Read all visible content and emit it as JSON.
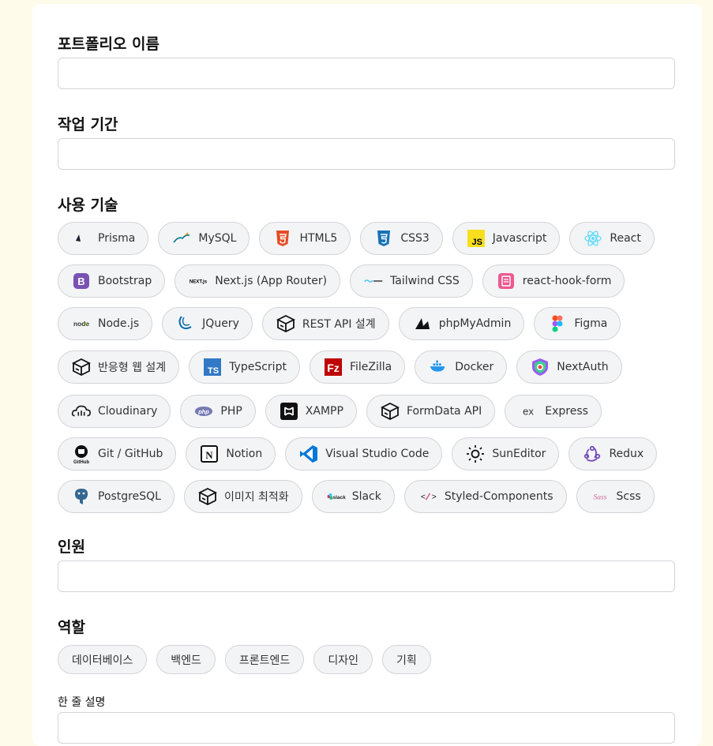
{
  "fields": {
    "name_label": "포트폴리오 이름",
    "period_label": "작업 기간",
    "tech_label": "사용 기술",
    "members_label": "인원",
    "role_label": "역할",
    "desc_label": "한 줄 설명"
  },
  "tech_rows": [
    [
      {
        "label": "Prisma",
        "icon": "prisma-icon",
        "icon_text": "Prisma"
      },
      {
        "label": "MySQL",
        "icon": "mysql-icon"
      },
      {
        "label": "HTML5",
        "icon": "html5-icon"
      },
      {
        "label": "CSS3",
        "icon": "css3-icon"
      },
      {
        "label": "Javascript",
        "icon": "javascript-icon"
      },
      {
        "label": "React",
        "icon": "react-icon"
      }
    ],
    [
      {
        "label": "Bootstrap",
        "icon": "bootstrap-icon"
      },
      {
        "label": "Next.js (App Router)",
        "icon": "nextjs-icon",
        "icon_text": "NEXT.js"
      },
      {
        "label": "Tailwind CSS",
        "icon": "tailwind-icon",
        "icon_text": "tailwindcss"
      },
      {
        "label": "react-hook-form",
        "icon": "react-hook-form-icon"
      }
    ],
    [
      {
        "label": "Node.js",
        "icon": "nodejs-icon",
        "icon_text": "node"
      },
      {
        "label": "JQuery",
        "icon": "jquery-icon"
      },
      {
        "label": "REST API 설계",
        "icon": "box-icon"
      },
      {
        "label": "phpMyAdmin",
        "icon": "phpmyadmin-icon"
      },
      {
        "label": "Figma",
        "icon": "figma-icon"
      }
    ],
    [
      {
        "label": "반응형 웹 설계",
        "icon": "box-icon"
      },
      {
        "label": "TypeScript",
        "icon": "typescript-icon"
      },
      {
        "label": "FileZilla",
        "icon": "filezilla-icon"
      },
      {
        "label": "Docker",
        "icon": "docker-icon",
        "icon_text": "docker"
      },
      {
        "label": "NextAuth",
        "icon": "nextauth-icon"
      }
    ],
    [
      {
        "label": "Cloudinary",
        "icon": "cloudinary-icon"
      },
      {
        "label": "PHP",
        "icon": "php-icon",
        "icon_text": "php"
      },
      {
        "label": "XAMPP",
        "icon": "xampp-icon"
      },
      {
        "label": "FormData API",
        "icon": "box-icon"
      },
      {
        "label": "Express",
        "icon": "express-icon",
        "icon_text": "ex"
      }
    ],
    [
      {
        "label": "Git / GitHub",
        "icon": "github-icon"
      },
      {
        "label": "Notion",
        "icon": "notion-icon"
      },
      {
        "label": "Visual Studio Code",
        "icon": "vscode-icon"
      },
      {
        "label": "SunEditor",
        "icon": "sun-icon"
      },
      {
        "label": "Redux",
        "icon": "redux-icon"
      }
    ],
    [
      {
        "label": "PostgreSQL",
        "icon": "postgresql-icon"
      },
      {
        "label": "이미지 최적화",
        "icon": "box-icon"
      },
      {
        "label": "Slack",
        "icon": "slack-icon",
        "icon_text": "slack"
      },
      {
        "label": "Styled-Components",
        "icon": "styled-components-icon"
      },
      {
        "label": "Scss",
        "icon": "sass-icon",
        "icon_text": "Sass"
      }
    ]
  ],
  "roles": [
    "데이터베이스",
    "백엔드",
    "프론트엔드",
    "디자인",
    "기획"
  ],
  "colors": {
    "background": "#fffbea",
    "card": "#ffffff",
    "chip_bg": "#f3f4f6",
    "chip_border": "#d4d4d8"
  }
}
